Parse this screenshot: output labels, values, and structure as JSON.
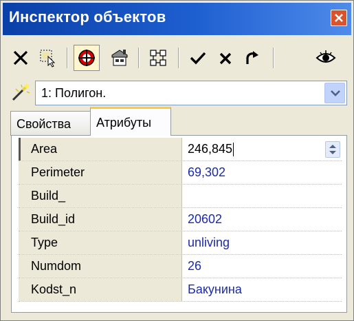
{
  "window": {
    "title": "Инспектор объектов"
  },
  "toolbar": {
    "buttons": [
      "delete-icon",
      "select-region-icon",
      "target-icon",
      "properties-icon",
      "group-icon",
      "apply-icon",
      "cancel-icon",
      "refresh-icon",
      "view-icon"
    ],
    "pressed": "target-icon"
  },
  "selector": {
    "value": "1: Полигон."
  },
  "tabs": {
    "properties": "Свойства",
    "attributes": "Атрибуты",
    "active": "attributes"
  },
  "attributes": {
    "rows": [
      {
        "name": "Area",
        "value": "246,845"
      },
      {
        "name": "Perimeter",
        "value": "69,302"
      },
      {
        "name": "Build_",
        "value": ""
      },
      {
        "name": "Build_id",
        "value": "20602"
      },
      {
        "name": "Type",
        "value": "unliving"
      },
      {
        "name": "Numdom",
        "value": "26"
      },
      {
        "name": "Kodst_n",
        "value": "Бакунина"
      }
    ]
  },
  "colors": {
    "titlebar": "#0A3FA8",
    "accent_tab": "#FFC83C",
    "value_text": "#1A2AA8",
    "panel": "#ECE9D8"
  }
}
